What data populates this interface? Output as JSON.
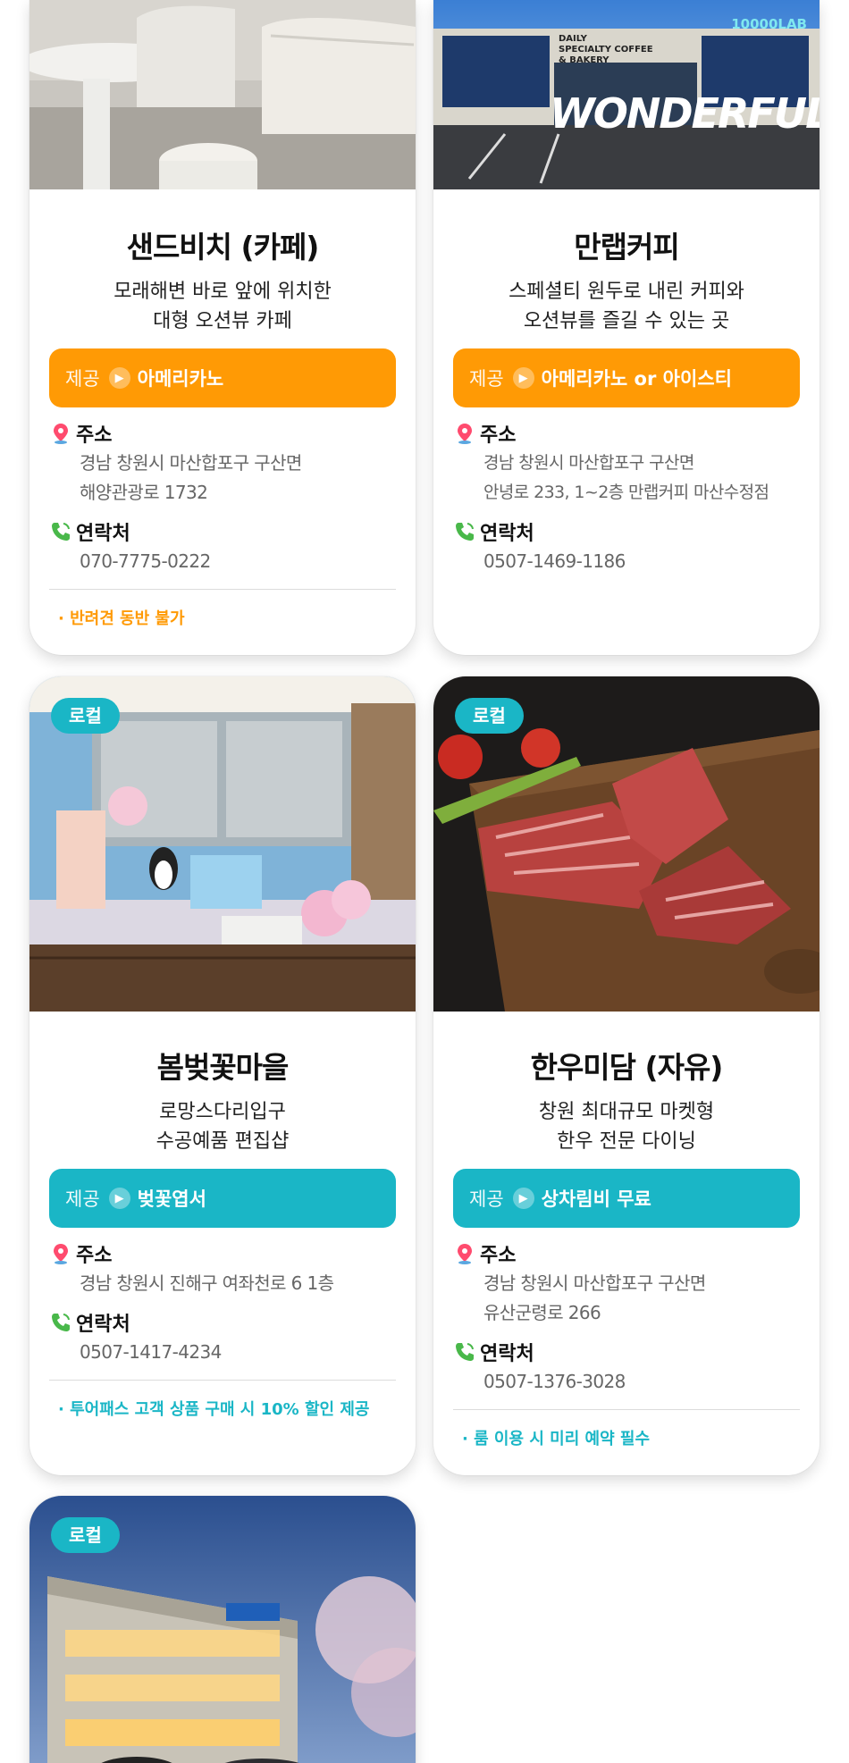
{
  "colors": {
    "orange": "#ff9a05",
    "teal": "#1ab6c6",
    "pin": "#ff4b6e",
    "phone": "#49b84a"
  },
  "labels": {
    "offer": "제공",
    "address": "주소",
    "contact": "연락처",
    "local_badge": "로컬"
  },
  "cards": [
    {
      "title": "샌드비치 (카페)",
      "desc_lines": [
        "모래해변 바로 앞에 위치한",
        "대형 오션뷰 카페"
      ],
      "offer": "아메리카노",
      "address_lines": [
        "경남 창원시 마산합포구 구산면",
        "해양관광로 1732"
      ],
      "phone": "070-7775-0222",
      "note": "· 반려견 동반 불가",
      "accent": "orange"
    },
    {
      "title": "만랩커피",
      "desc_lines": [
        "스페셜티 원두로 내린 커피와",
        "오션뷰를 즐길 수 있는 곳"
      ],
      "offer": "아메리카노 or 아이스티",
      "address_lines": [
        "경남 창원시 마산합포구 구산면",
        "안녕로 233, 1~2층 만랩커피 마산수정점"
      ],
      "phone": "0507-1469-1186",
      "accent": "orange",
      "photo_sign": [
        "DAILY",
        "SPECIALTY COFFEE",
        "& BAKERY"
      ],
      "photo_logo": "10000LAB",
      "photo_word": "WONDERFUL"
    },
    {
      "badge": "로컬",
      "title": "봄벚꽃마을",
      "desc_lines": [
        "로망스다리입구",
        "수공예품 편집샵"
      ],
      "offer": "벚꽃엽서",
      "address_lines": [
        "경남 창원시 진해구 여좌천로 6 1층"
      ],
      "phone": "0507-1417-4234",
      "note": "· 투어패스 고객 상품 구매 시 10% 할인 제공",
      "accent": "teal"
    },
    {
      "badge": "로컬",
      "title": "한우미담 (자유)",
      "desc_lines": [
        "창원 최대규모 마켓형",
        "한우 전문 다이닝"
      ],
      "offer": "상차림비 무료",
      "address_lines": [
        "경남 창원시 마산합포구 구산면",
        "유산군령로 266"
      ],
      "phone": "0507-1376-3028",
      "note": "· 룸 이용 시 미리 예약 필수",
      "accent": "teal"
    },
    {
      "badge": "로컬"
    }
  ]
}
